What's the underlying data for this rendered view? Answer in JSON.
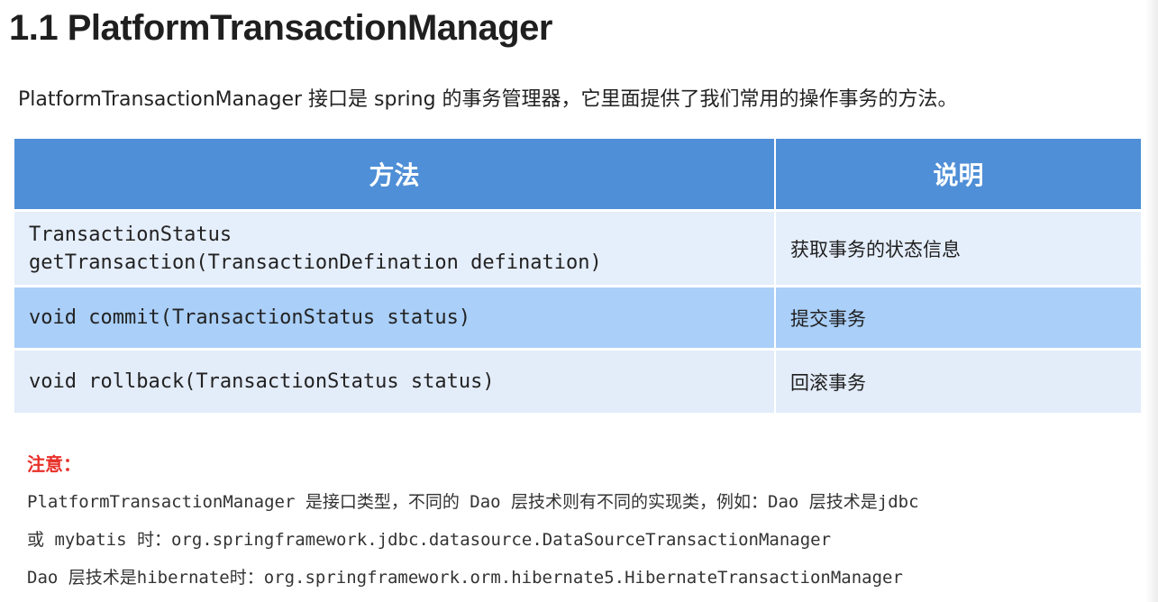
{
  "title": "1.1 PlatformTransactionManager",
  "intro": "PlatformTransactionManager 接口是 spring 的事务管理器，它里面提供了我们常用的操作事务的方法。",
  "table": {
    "headers": [
      "方法",
      "说明"
    ],
    "rows": [
      {
        "method": "TransactionStatus\ngetTransaction(TransactionDefination defination)",
        "desc": "获取事务的状态信息"
      },
      {
        "method": "void commit(TransactionStatus status)",
        "desc": "提交事务"
      },
      {
        "method": "void rollback(TransactionStatus status)",
        "desc": "回滚事务"
      }
    ]
  },
  "note": {
    "title": "注意：",
    "lines": [
      "PlatformTransactionManager 是接口类型，不同的 Dao 层技术则有不同的实现类，例如：Dao 层技术是jdbc",
      "或 mybatis 时：org.springframework.jdbc.datasource.DataSourceTransactionManager",
      "Dao 层技术是hibernate时：org.springframework.orm.hibernate5.HibernateTransactionManager"
    ]
  },
  "colors": {
    "header_bg": "#4f8fd7",
    "row_light": "#e5eefb",
    "row_highlight": "#aacff8",
    "note_title": "#e8302a"
  }
}
